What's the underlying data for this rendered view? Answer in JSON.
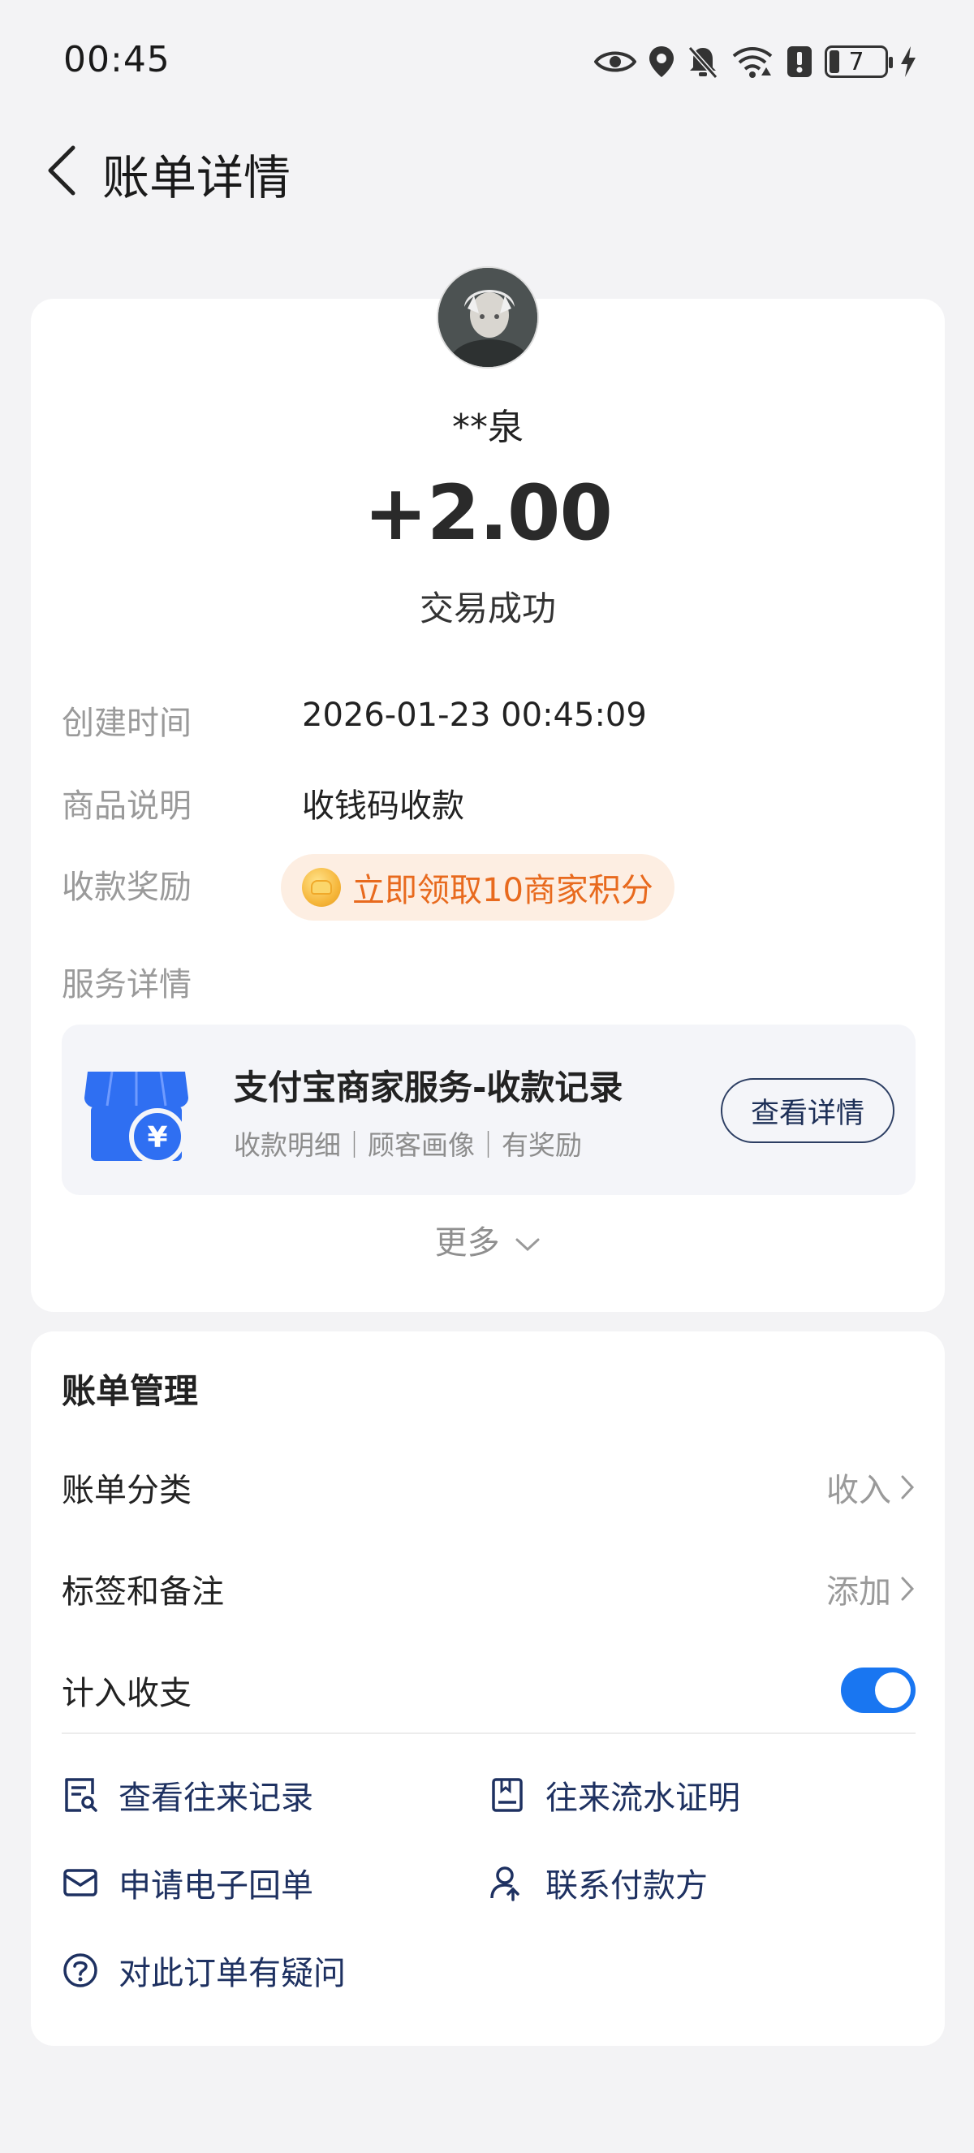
{
  "statusbar": {
    "time": "00:45",
    "battery": "7"
  },
  "header": {
    "title": "账单详情"
  },
  "summary": {
    "payer_name": "**泉",
    "amount": "+2.00",
    "status": "交易成功"
  },
  "details": {
    "created_label": "创建时间",
    "created_value": "2026-01-23 00:45:09",
    "desc_label": "商品说明",
    "desc_value": "收钱码收款",
    "reward_label": "收款奖励",
    "reward_text": "立即领取10商家积分",
    "service_label": "服务详情"
  },
  "service": {
    "title": "支付宝商家服务-收款记录",
    "subtitle": "收款明细｜顾客画像｜有奖励",
    "button": "查看详情"
  },
  "more": "更多",
  "management": {
    "title": "账单管理",
    "category_label": "账单分类",
    "category_value": "收入",
    "tags_label": "标签和备注",
    "tags_value": "添加",
    "include_label": "计入收支",
    "include_on": true
  },
  "actions": {
    "records": "查看往来记录",
    "statement": "往来流水证明",
    "receipt": "申请电子回单",
    "contact": "联系付款方",
    "question": "对此订单有疑问"
  },
  "colors": {
    "accent": "#1976f1",
    "link": "#1e3161",
    "reward": "#e86a1e",
    "reward_bg": "#fdeee2"
  }
}
